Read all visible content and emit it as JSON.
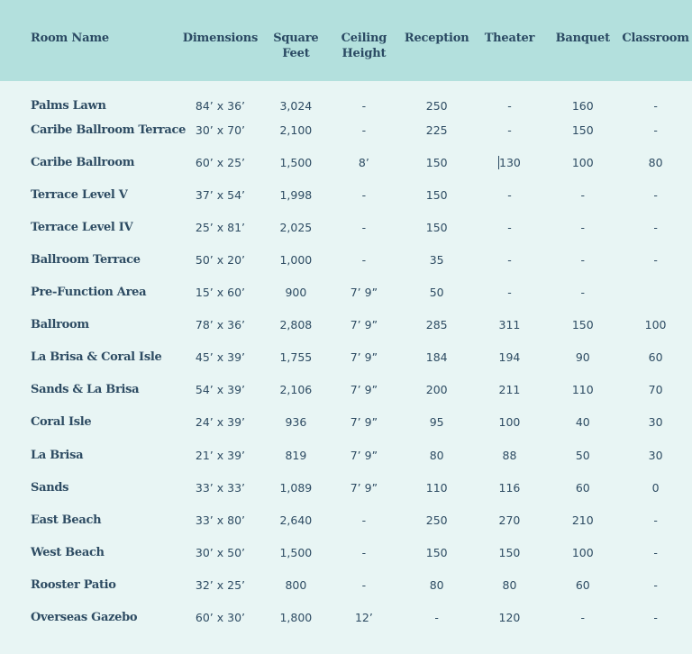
{
  "table": {
    "headers": [
      [
        "Room Name"
      ],
      [
        "Dimensions"
      ],
      [
        "Square",
        "Feet"
      ],
      [
        "Ceiling",
        "Height"
      ],
      [
        "Reception"
      ],
      [
        "Theater"
      ],
      [
        "Banquet"
      ],
      [
        "Classroom"
      ]
    ],
    "rows": [
      [
        "Palms Lawn",
        "84’ x 36’",
        "3,024",
        "-",
        "250",
        "-",
        "160",
        "-"
      ],
      [
        "Caribe Ballroom Terrace",
        "30’ x 70’",
        "2,100",
        "-",
        "225",
        "-",
        "150",
        "-"
      ],
      [
        "Caribe Ballroom",
        "60’ x 25’",
        "1,500",
        "8’",
        "150",
        "130",
        "100",
        "80"
      ],
      [
        "Terrace Level V",
        "37’ x 54’",
        "1,998",
        "-",
        "150",
        "-",
        "-",
        "-"
      ],
      [
        "Terrace Level IV",
        "25’ x 81’",
        "2,025",
        "-",
        "150",
        "-",
        "-",
        "-"
      ],
      [
        "Ballroom Terrace",
        "50’ x 20’",
        "1,000",
        "-",
        "35",
        "-",
        "-",
        "-"
      ],
      [
        "Pre-Function Area",
        "15’ x 60’",
        "900",
        "7’ 9”",
        "50",
        "-",
        "-",
        ""
      ],
      [
        "Ballroom",
        "78’ x 36’",
        "2,808",
        "7’ 9”",
        "285",
        "311",
        "150",
        "100"
      ],
      [
        "La Brisa & Coral Isle",
        "45’ x 39’",
        "1,755",
        "7’ 9”",
        "184",
        "194",
        "90",
        "60"
      ],
      [
        "Sands & La Brisa",
        "54’ x 39’",
        "2,106",
        "7’ 9”",
        "200",
        "211",
        "110",
        "70"
      ],
      [
        "Coral Isle",
        "24’ x 39’",
        "936",
        "7’ 9”",
        "95",
        "100",
        "40",
        "30"
      ],
      [
        "La Brisa",
        "21’ x 39’",
        "819",
        "7’ 9”",
        "80",
        "88",
        "50",
        "30"
      ],
      [
        "Sands",
        "33’ x 33’",
        "1,089",
        "7’ 9”",
        "110",
        "116",
        "60",
        "0"
      ],
      [
        "East Beach",
        "33’ x 80’",
        "2,640",
        "-",
        "250",
        "270",
        "210",
        "-"
      ],
      [
        "West Beach",
        "30’ x 50’",
        "1,500",
        "-",
        "150",
        "150",
        "100",
        "-"
      ],
      [
        "Rooster Patio",
        "32’ x 25’",
        "800",
        "-",
        "80",
        "80",
        "60",
        "-"
      ],
      [
        "Overseas Gazebo",
        "60’ x 30’",
        "1,800",
        "12’",
        "-",
        "120",
        "-",
        "-"
      ]
    ]
  }
}
